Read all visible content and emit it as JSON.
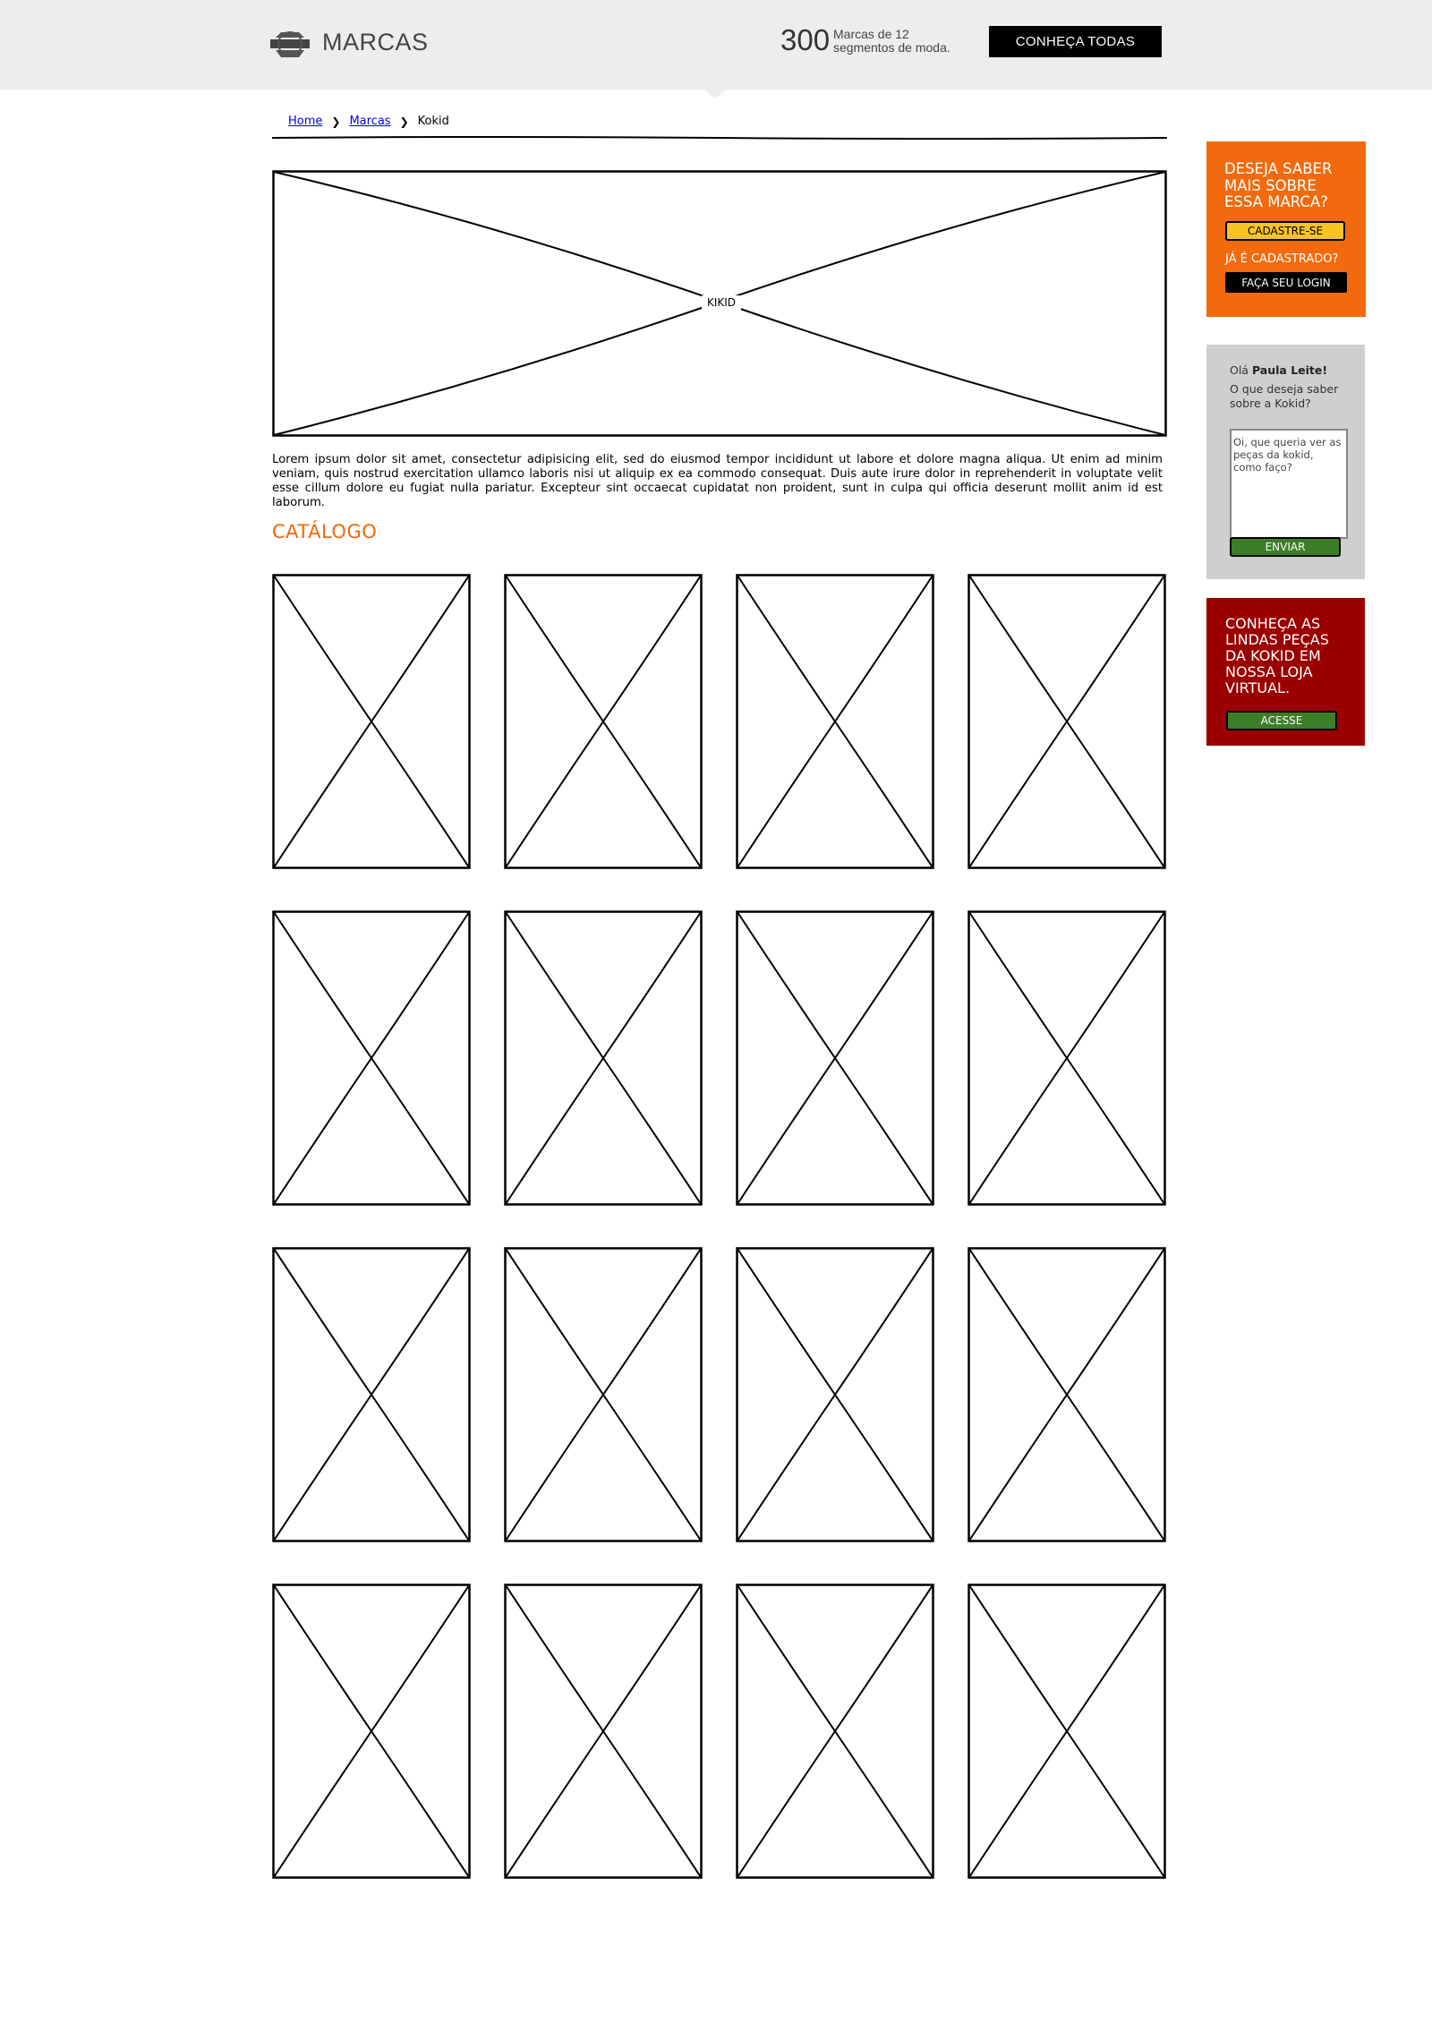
{
  "header": {
    "logo_text": "MARCAS",
    "count": "300",
    "count_desc": "Marcas de 12 segmentos de moda.",
    "cta_label": "CONHEÇA TODAS"
  },
  "breadcrumb": {
    "home": "Home",
    "marcas": "Marcas",
    "current": "Kokid"
  },
  "hero": {
    "label": "KIKID"
  },
  "description": "Lorem ipsum dolor sit amet, consectetur adipisicing elit, sed do eiusmod tempor incididunt ut labore et dolore magna aliqua. Ut enim ad minim veniam, quis nostrud exercitation ullamco laboris nisi ut aliquip ex ea commodo consequat. Duis aute irure dolor in reprehenderit in voluptate velit esse cillum dolore eu fugiat nulla pariatur. Excepteur sint occaecat cupidatat non proident, sunt in culpa qui officia deserunt mollit anim id est laborum.",
  "catalog": {
    "title": "CATÁLOGO",
    "rows": 4,
    "cols": 4
  },
  "sidebar": {
    "signup": {
      "title": "DESEJA SABER MAIS SOBRE ESSA MARCA?",
      "signup_label": "CADASTRE-SE",
      "already": "JÁ É CADASTRADO?",
      "login_label": "FAÇA SEU LOGIN"
    },
    "ask": {
      "greeting": "Olá",
      "user": "Paula Leite!",
      "question": "O que deseja saber sobre a Kokid?",
      "message": "Oi, que queria ver as peças da kokid, como faço?",
      "send_label": "ENVIAR"
    },
    "store": {
      "title": "CONHEÇA AS LINDAS PEÇAS DA KOKID EM NOSSA LOJA VIRTUAL.",
      "access_label": "ACESSE"
    }
  },
  "colors": {
    "header_bg": "#ededed",
    "accent_orange": "#f26a0d",
    "catalog_title": "#f06a0d",
    "sidebar_gray": "#cfcfcf",
    "sidebar_red": "#9a0000",
    "button_yellow": "#f7c325",
    "button_green": "#3e7d28"
  }
}
